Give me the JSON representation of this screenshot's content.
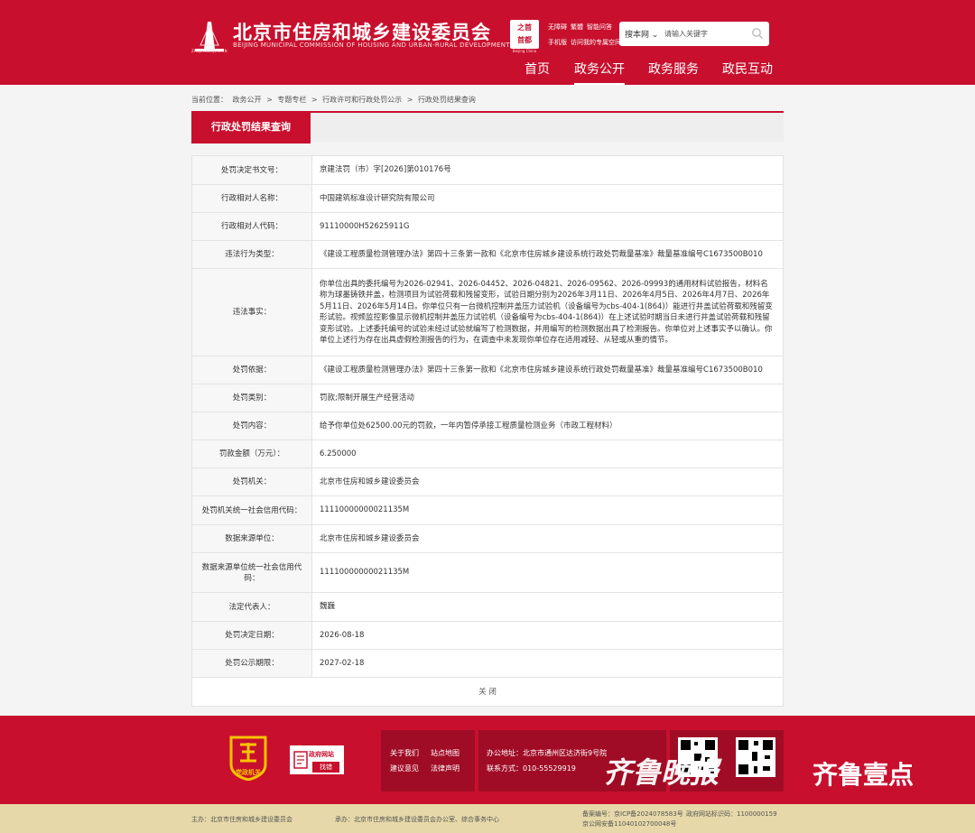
{
  "header": {
    "site_title": "北京市住房和城乡建设委员会",
    "site_subtitle": "BEIJING MUNICIPAL COMMISSION OF HOUSING AND URBAN-RURAL DEVELOPMENT",
    "logo_caption": "ZHUJIANWEIJIAN.CN",
    "capital_badge_line1": "之首",
    "capital_badge_line2": "首都",
    "capital_caption": "Beijing China",
    "quick_links": [
      "无障碍",
      "繁體",
      "智能问答",
      "手机版",
      "访问我的专属空间"
    ],
    "search": {
      "select_label": "搜本网",
      "placeholder": "请输入关键字"
    },
    "nav": [
      {
        "label": "首页"
      },
      {
        "label": "政务公开"
      },
      {
        "label": "政务服务"
      },
      {
        "label": "政民互动"
      }
    ]
  },
  "breadcrumb": {
    "prefix": "当前位置：",
    "items": [
      "政务公开",
      "专题专栏",
      "行政许可和行政处罚公示",
      "行政处罚结果查询"
    ],
    "separator": ">"
  },
  "section": {
    "title": "行政处罚结果查询"
  },
  "rows": [
    {
      "label": "处罚决定书文号：",
      "value": "京建法罚（市）字[2026]第010176号"
    },
    {
      "label": "行政相对人名称：",
      "value": "中国建筑标准设计研究院有限公司"
    },
    {
      "label": "行政相对人代码：",
      "value": "91110000H52625911G"
    },
    {
      "label": "违法行为类型：",
      "value": "《建设工程质量检测管理办法》第四十三条第一款和《北京市住房城乡建设系统行政处罚裁量基准》裁量基准编号C1673500B010"
    },
    {
      "label": "违法事实：",
      "value": "你单位出具的委托编号为2026-02941、2026-04452、2026-04821、2026-09562、2026-09993的通用材料试验报告，材料名称为球墨铸铁井盖，检测项目为试验荷载和残留变形，试验日期分别为2026年3月11日、2026年4月5日、2026年4月7日、2026年5月11日、2026年5月14日。你单位只有一台微机控制井盖压力试验机（设备编号为cbs-404-1(864)）能进行井盖试验荷载和残留变形试验。视频监控影像显示微机控制井盖压力试验机（设备编号为cbs-404-1(864)）在上述试验时期当日未进行井盖试验荷载和残留变形试验。上述委托编号的试验未经过试验就编写了检测数据，并用编写的检测数据出具了检测报告。你单位对上述事实予以确认。你单位上述行为存在出具虚假检测报告的行为，在调查中未发现你单位存在适用减轻、从轻或从重的情节。"
    },
    {
      "label": "处罚依据：",
      "value": "《建设工程质量检测管理办法》第四十三条第一款和《北京市住房城乡建设系统行政处罚裁量基准》裁量基准编号C1673500B010"
    },
    {
      "label": "处罚类别：",
      "value": "罚款;限制开展生产经营活动"
    },
    {
      "label": "处罚内容：",
      "value": "给予你单位处62500.00元的罚款，一年内暂停承接工程质量检测业务（市政工程材料）"
    },
    {
      "label": "罚款金额（万元）：",
      "value": "6.250000"
    },
    {
      "label": "处罚机关：",
      "value": "北京市住房和城乡建设委员会"
    },
    {
      "label": "处罚机关统一社会信用代码：",
      "value": "11110000000021135M"
    },
    {
      "label": "数据来源单位：",
      "value": "北京市住房和城乡建设委员会"
    },
    {
      "label": "数据来源单位统一社会信用代码：",
      "value": "11110000000021135M"
    },
    {
      "label": "法定代表人：",
      "value": "魏巍"
    },
    {
      "label": "处罚决定日期：",
      "value": "2026-08-18"
    },
    {
      "label": "处罚公示期限：",
      "value": "2027-02-18"
    }
  ],
  "close_label": "关 闭",
  "footer": {
    "party_caption": "党政机关",
    "error_badge_top": "政府网站",
    "error_badge_bottom": "找错",
    "links": [
      "关于我们",
      "站点地图",
      "建议意见",
      "法律声明"
    ],
    "address": "办公地址：北京市通州区达济街9号院",
    "phone": "联系方式：010-55529919",
    "watermark": "齐鲁晚报",
    "watermark_badge": "壹点",
    "watermark_brand": "齐鲁壹点"
  },
  "bottom": {
    "sponsor": "主办：北京市住房和城乡建设委员会",
    "organizer": "承办：北京市住房和城乡建设委员会办公室、综合事务中心",
    "icp": "备案编号：京ICP备2024078583号",
    "site_code": "政府网站标识码：1100000159",
    "police": "京公网安备11040102700048号"
  },
  "colors": {
    "brand_red": "#c8102e",
    "footer_dark": "#a00c25",
    "bottom_bar": "#e6d8a8"
  }
}
